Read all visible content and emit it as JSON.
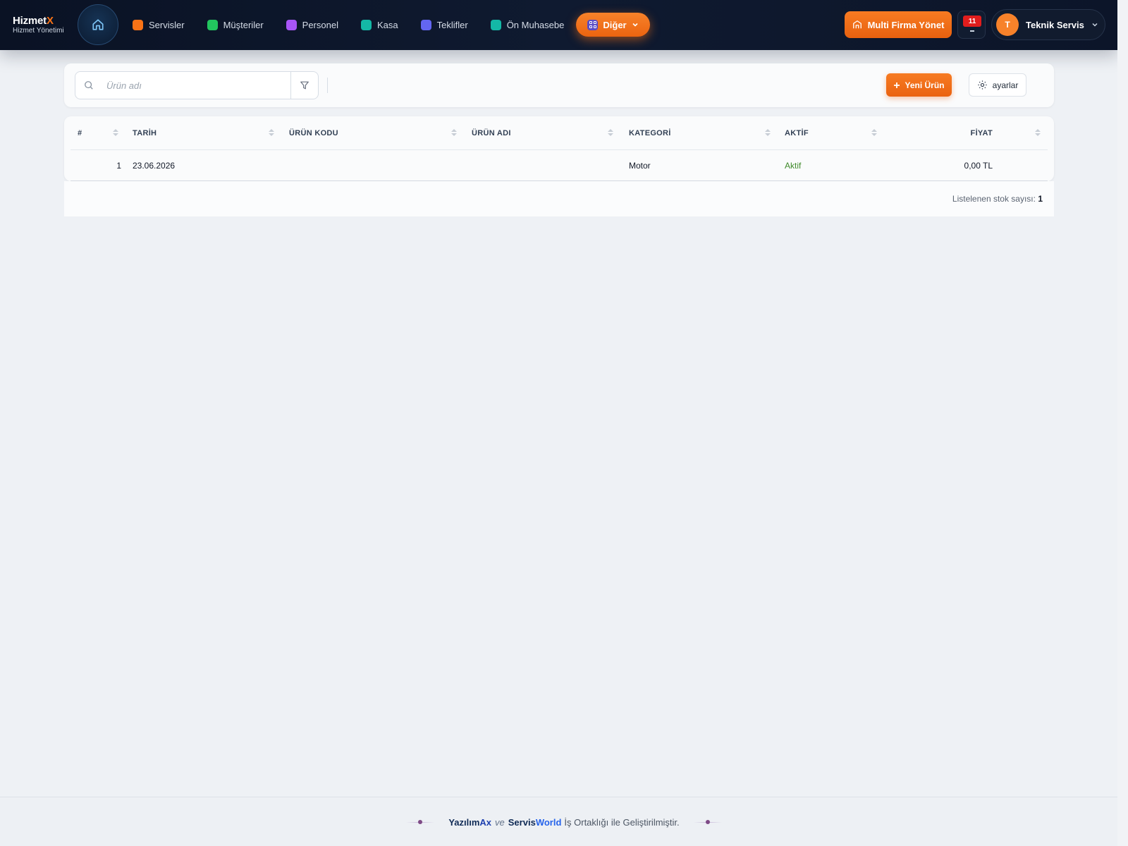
{
  "brand": {
    "name_main": "Hizmet",
    "name_accent": "X",
    "subtitle": "Hizmet Yönetimi"
  },
  "nav": {
    "items": [
      {
        "label": "Servisler",
        "color": "#f97316"
      },
      {
        "label": "Müşteriler",
        "color": "#22c55e"
      },
      {
        "label": "Personel",
        "color": "#a855f7"
      },
      {
        "label": "Kasa",
        "color": "#14b8a6"
      },
      {
        "label": "Teklifler",
        "color": "#6366f1"
      },
      {
        "label": "Ön Muhasebe",
        "color": "#14b8a6"
      }
    ],
    "more_label": "Diğer",
    "multi_company_label": "Multi Firma Yönet",
    "notification_count": "11",
    "user_initial": "T",
    "user_name": "Teknik Servis"
  },
  "toolbar": {
    "search_placeholder": "Ürün adı",
    "search_value": "",
    "new_button": "Yeni Ürün",
    "settings_button": "ayarlar"
  },
  "table": {
    "columns": [
      "#",
      "TARİH",
      "ÜRÜN KODU",
      "ÜRÜN ADI",
      "KATEGORİ",
      "AKTİF",
      "FİYAT"
    ],
    "rows": [
      {
        "no": "1",
        "date": "23.06.2026",
        "code": "",
        "name": "",
        "category": "Motor",
        "active": "Aktif",
        "price": "0,00 TL"
      }
    ]
  },
  "summary": {
    "label": "Listelenen stok sayısı:",
    "count": "1"
  },
  "footer": {
    "brand1_main": "Yazılım",
    "brand1_accent": "Ax",
    "and": "ve",
    "brand2_main": "Servis",
    "brand2_accent": "World",
    "text": "İş Ortaklığı ile Geliştirilmiştir."
  },
  "colors": {
    "accent": "#f97316",
    "nav_bg": "#0a1224",
    "active_green": "#3f8a2a",
    "badge_red": "#e11d1d"
  }
}
